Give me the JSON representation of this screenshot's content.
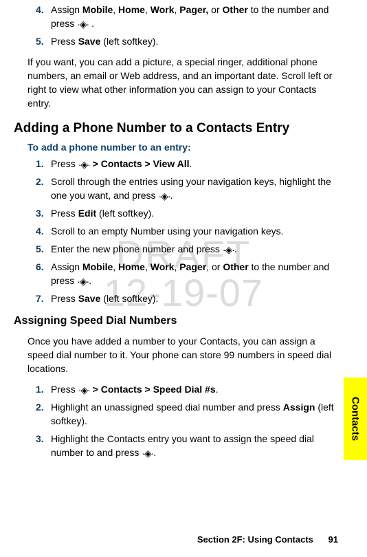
{
  "watermark": {
    "line1": "DRAFT",
    "line2": "12-19-07"
  },
  "nav_icon": "·◈·",
  "opening_steps": [
    {
      "n": "4.",
      "pre": "Assign ",
      "bold_seq": [
        "Mobile",
        ", ",
        "Home",
        ", ",
        "Work",
        ", ",
        "Pager,",
        " or ",
        "Other"
      ],
      "post1": " to the number and press ",
      "post2": " ."
    },
    {
      "n": "5.",
      "pre": "Press ",
      "bold": "Save",
      "post": " (left softkey)."
    }
  ],
  "opening_para": "If you want, you can add a picture, a special ringer, additional phone numbers, an email or Web address, and an important date. Scroll left or right to view what other information you can assign to your Contacts entry.",
  "section1": {
    "heading": "Adding a Phone Number to a Contacts Entry",
    "subhead": "To add a phone number to an entry:",
    "steps": [
      {
        "n": "1.",
        "pre": "Press ",
        "icon": true,
        "bold": " > Contacts > View All",
        "post": "."
      },
      {
        "n": "2.",
        "text_pre": "Scroll through the entries using your navigation keys, highlight the one you want, and press ",
        "icon": true,
        "post": "."
      },
      {
        "n": "3.",
        "pre": "Press ",
        "bold": "Edit",
        "post": " (left softkey)."
      },
      {
        "n": "4.",
        "text": "Scroll to an empty Number using your navigation keys."
      },
      {
        "n": "5.",
        "text_pre": "Enter the new phone number and press ",
        "icon": true,
        "post": "."
      },
      {
        "n": "6.",
        "pre": "Assign ",
        "bold_seq": [
          "Mobile",
          ", ",
          "Home",
          ", ",
          "Work",
          ", ",
          "Pager",
          ", or ",
          "Other"
        ],
        "post1": " to the number and press ",
        "icon": true,
        "post2": "."
      },
      {
        "n": "7.",
        "pre": "Press ",
        "bold": "Save",
        "post": " (left softkey)."
      }
    ]
  },
  "section2": {
    "heading": "Assigning Speed Dial Numbers",
    "para": "Once you have added a number to your Contacts, you can assign a speed dial number to it. Your phone can store 99 numbers in speed dial locations.",
    "steps": [
      {
        "n": "1.",
        "pre": "Press ",
        "icon": true,
        "bold": " > Contacts > Speed Dial #s",
        "post": "."
      },
      {
        "n": "2.",
        "text_pre": "Highlight an unassigned speed dial number and press ",
        "bold": "Assign",
        "post": " (left softkey)."
      },
      {
        "n": "3.",
        "text_pre": "Highlight the Contacts entry you want to assign the speed dial number to and press ",
        "icon": true,
        "post": "."
      }
    ]
  },
  "sidetab": "Contacts",
  "footer": {
    "section": "Section 2F: Using Contacts",
    "page": "91"
  }
}
